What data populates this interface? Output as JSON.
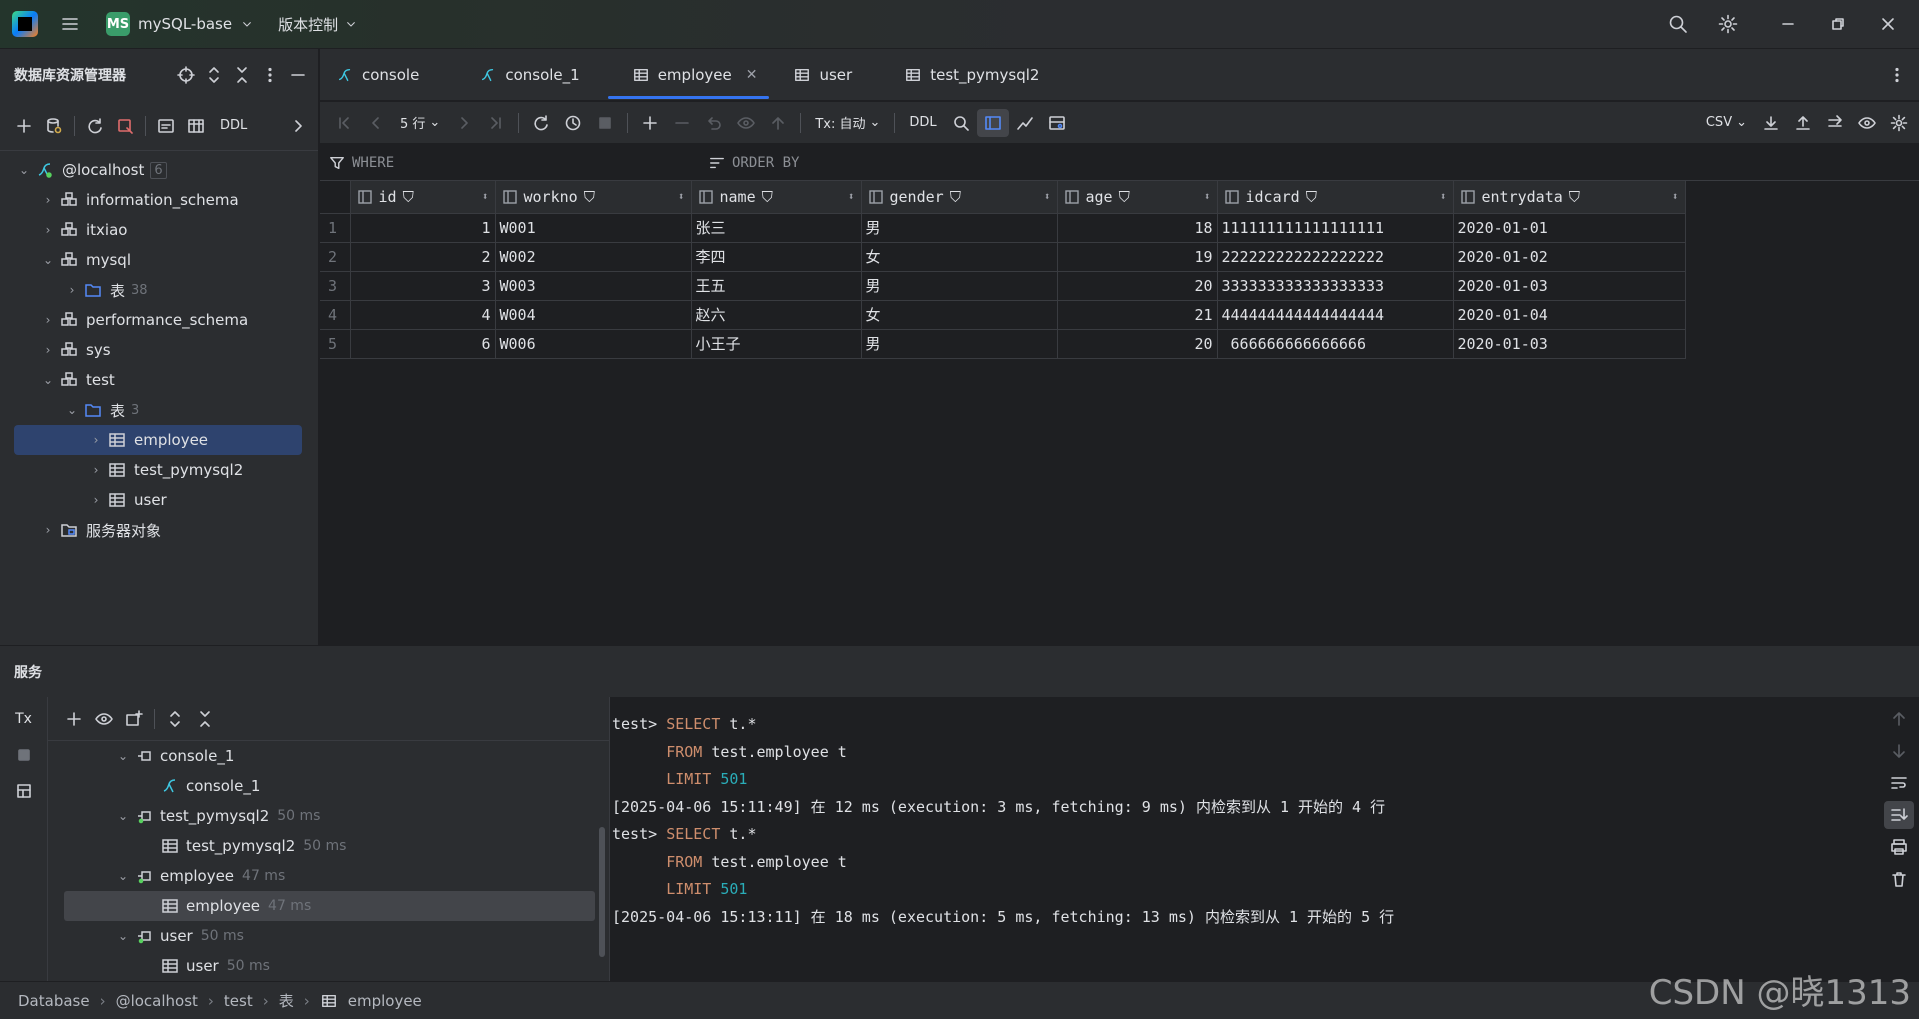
{
  "window": {
    "project_badge": "MS",
    "project_name": "mySQL-base",
    "version_control": "版本控制"
  },
  "db_explorer": {
    "title": "数据库资源管理器",
    "ddl_label": "DDL",
    "tree": [
      {
        "label": "@localhost",
        "count": "6"
      },
      {
        "label": "information_schema"
      },
      {
        "label": "itxiao"
      },
      {
        "label": "mysql"
      },
      {
        "label": "表",
        "count": "38"
      },
      {
        "label": "performance_schema"
      },
      {
        "label": "sys"
      },
      {
        "label": "test"
      },
      {
        "label": "表",
        "count": "3"
      },
      {
        "label": "employee"
      },
      {
        "label": "test_pymysql2"
      },
      {
        "label": "user"
      },
      {
        "label": "服务器对象"
      }
    ]
  },
  "tabs": [
    "console",
    "console_1",
    "employee",
    "user",
    "test_pymysql2"
  ],
  "grid_toolbar": {
    "rows": "5 行",
    "tx": "Tx: 自动",
    "ddl": "DDL",
    "export": "CSV"
  },
  "filter": {
    "where": "WHERE",
    "order_by": "ORDER BY"
  },
  "table": {
    "columns": [
      "id",
      "workno",
      "name",
      "gender",
      "age",
      "idcard",
      "entrydata"
    ],
    "rows": [
      [
        "1",
        "1",
        "W001",
        "张三",
        "男",
        "18",
        "111111111111111111",
        "2020-01-01"
      ],
      [
        "2",
        "2",
        "W002",
        "李四",
        "女",
        "19",
        "222222222222222222",
        "2020-01-02"
      ],
      [
        "3",
        "3",
        "W003",
        "王五",
        "男",
        "20",
        "333333333333333333",
        "2020-01-03"
      ],
      [
        "4",
        "4",
        "W004",
        "赵六",
        "女",
        "21",
        "444444444444444444",
        "2020-01-04"
      ],
      [
        "5",
        "6",
        "W006",
        "小王子",
        "男",
        "20",
        " 666666666666666",
        "2020-01-03"
      ]
    ]
  },
  "services": {
    "title": "服务",
    "tx_label": "Tx",
    "tree": [
      {
        "label": "console_1",
        "time": ""
      },
      {
        "label": "console_1",
        "time": ""
      },
      {
        "label": "test_pymysql2",
        "time": "50 ms"
      },
      {
        "label": "test_pymysql2",
        "time": "50 ms"
      },
      {
        "label": "employee",
        "time": "47 ms"
      },
      {
        "label": "employee",
        "time": "47 ms"
      },
      {
        "label": "user",
        "time": "50 ms"
      },
      {
        "label": "user",
        "time": "50 ms"
      }
    ]
  },
  "console": {
    "prompt": "test>",
    "kw_select": "SELECT",
    "sel_expr": "t.*",
    "kw_from": "FROM",
    "from_expr": "test.employee t",
    "kw_limit": "LIMIT",
    "limit_val": "501",
    "log1": "[2025-04-06 15:11:49] 在 12 ms (execution: 3 ms, fetching: 9 ms) 内检索到从 1 开始的 4 行",
    "log2": "[2025-04-06 15:13:11] 在 18 ms (execution: 5 ms, fetching: 13 ms) 内检索到从 1 开始的 5 行"
  },
  "breadcrumb": [
    "Database",
    "@localhost",
    "test",
    "表",
    "employee"
  ],
  "watermark": "CSDN @晓1313"
}
